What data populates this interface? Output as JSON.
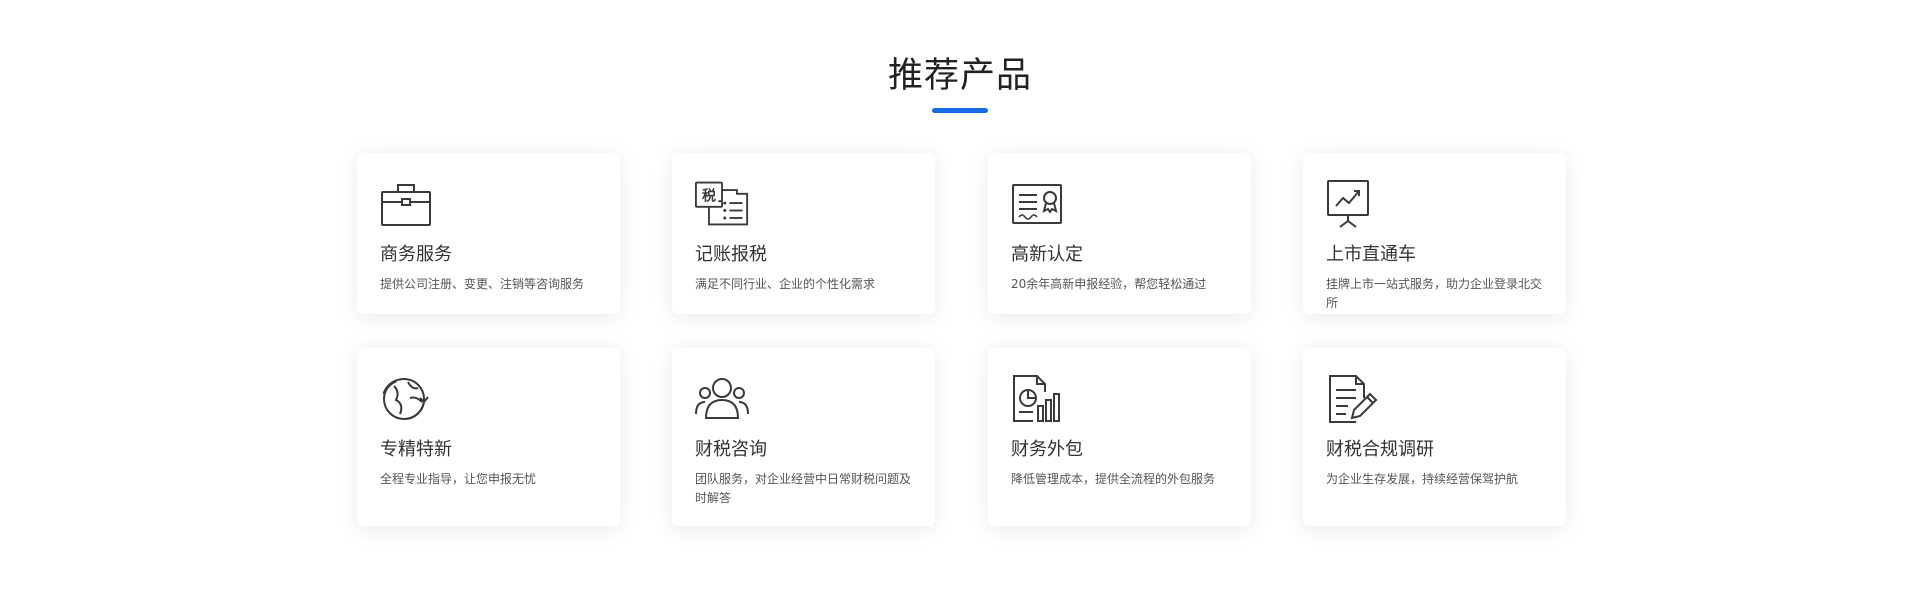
{
  "section": {
    "title": "推荐产品"
  },
  "colors": {
    "accent": "#1a6bea",
    "card_background": "#ffffff",
    "title_text": "#222222",
    "body_text": "#555555"
  },
  "products": [
    {
      "icon": "briefcase-icon",
      "title": "商务服务",
      "desc": "提供公司注册、变更、注销等咨询服务"
    },
    {
      "icon": "tax-document-icon",
      "title": "记账报税",
      "desc": "满足不同行业、企业的个性化需求"
    },
    {
      "icon": "certificate-icon",
      "title": "高新认定",
      "desc": "20余年高新申报经验，帮您轻松通过"
    },
    {
      "icon": "presentation-chart-icon",
      "title": "上市直通车",
      "desc": "挂牌上市一站式服务，助力企业登录北交所"
    },
    {
      "icon": "globe-refresh-icon",
      "title": "专精特新",
      "desc": "全程专业指导，让您申报无忧"
    },
    {
      "icon": "team-users-icon",
      "title": "财税咨询",
      "desc": "团队服务，对企业经营中日常财税问题及时解答"
    },
    {
      "icon": "report-chart-icon",
      "title": "财务外包",
      "desc": "降低管理成本，提供全流程的外包服务"
    },
    {
      "icon": "document-edit-icon",
      "title": "财税合规调研",
      "desc": "为企业生存发展，持续经营保驾护航"
    }
  ]
}
